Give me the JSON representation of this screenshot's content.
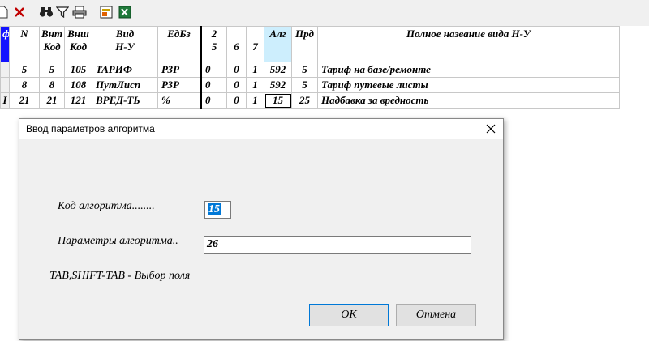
{
  "grid": {
    "headers": {
      "n": "N",
      "vnt": [
        "Внт",
        "Код"
      ],
      "vnsh": [
        "Внш",
        "Код"
      ],
      "vid": [
        "Вид",
        "Н-У"
      ],
      "edbz": "ЕдБз",
      "c2": [
        "2",
        "5"
      ],
      "c6": "6",
      "c7": "7",
      "alg": "Алг",
      "prd": "Прд",
      "name": "Полное название вида Н-У"
    },
    "rows": [
      {
        "first": "",
        "n": "5",
        "vnt": "5",
        "vnsh": "105",
        "vid": "ТАРИФ",
        "edbz": "РЗР",
        "c2": "0",
        "c6": "0",
        "c7": "1",
        "alg": "592",
        "prd": "5",
        "name": "Тариф на базе/ремонте"
      },
      {
        "first": "",
        "n": "8",
        "vnt": "8",
        "vnsh": "108",
        "vid": "ПутЛисп",
        "edbz": "РЗР",
        "c2": "0",
        "c6": "0",
        "c7": "1",
        "alg": "592",
        "prd": "5",
        "name": "Тариф путевые листы"
      },
      {
        "first": "I",
        "n": "21",
        "vnt": "21",
        "vnsh": "121",
        "vid": "ВРЕД-ТЬ",
        "edbz": "%",
        "c2": "0",
        "c6": "0",
        "c7": "1",
        "alg": "15",
        "prd": "25",
        "name": "Надбавка за вредность"
      }
    ],
    "first_header": "ф"
  },
  "dialog": {
    "title": "Ввод параметров алгоритма",
    "code_label": "Код алгоритма........",
    "code_value": "15",
    "params_label": "Параметры алгоритма..",
    "params_value": "26",
    "hint": "TAB,SHIFT-TAB - Выбор поля",
    "ok": "OK",
    "cancel": "Отмена"
  }
}
